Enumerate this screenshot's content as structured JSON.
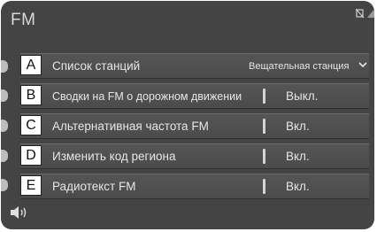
{
  "header": {
    "title": "FM"
  },
  "rows": [
    {
      "badge": "A",
      "label": "Список станций",
      "value": "Вещательная станция",
      "type": "dropdown"
    },
    {
      "badge": "B",
      "label": "Сводки на FM о дорожном движении",
      "value": "Выкл.",
      "type": "toggle"
    },
    {
      "badge": "C",
      "label": "Альтернативная частота FM",
      "value": "Вкл.",
      "type": "toggle"
    },
    {
      "badge": "D",
      "label": "Изменить код региона",
      "value": "Вкл.",
      "type": "toggle"
    },
    {
      "badge": "E",
      "label": "Радиотекст FM",
      "value": "Вкл.",
      "type": "toggle"
    }
  ],
  "icons": {
    "status": "no-connection-icon",
    "signal": "signal-icon",
    "volume": "speaker-icon",
    "dropdown": "chevron-down-icon"
  }
}
